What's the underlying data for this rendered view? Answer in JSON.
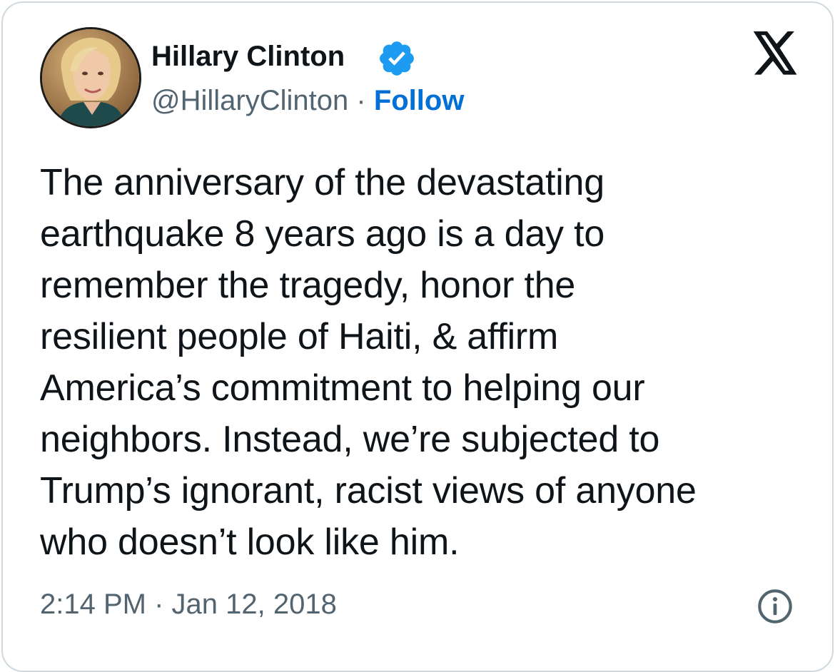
{
  "author": {
    "display_name": "Hillary Clinton",
    "handle": "@HillaryClinton",
    "separator": "·",
    "follow_label": "Follow",
    "verified_icon": "verified-badge-icon",
    "avatar_icon": "profile-photo"
  },
  "brand": {
    "logo": "x-logo-icon"
  },
  "tweet": {
    "lines": [
      "The anniversary of the devastating",
      "earthquake 8 years ago is a day to",
      "remember the tragedy, honor the",
      "resilient people of Haiti, & affirm",
      "America’s commitment to helping our",
      "neighbors. Instead, we’re subjected to",
      "Trump’s ignorant, racist views of anyone",
      "who doesn’t look like him."
    ]
  },
  "meta": {
    "timestamp": "2:14 PM · Jan 12, 2018",
    "info_icon": "info-icon"
  },
  "colors": {
    "text": "#0f1419",
    "secondary": "#536471",
    "link": "#006fd6",
    "verified": "#1d9bf0",
    "border": "#cfd9de"
  }
}
